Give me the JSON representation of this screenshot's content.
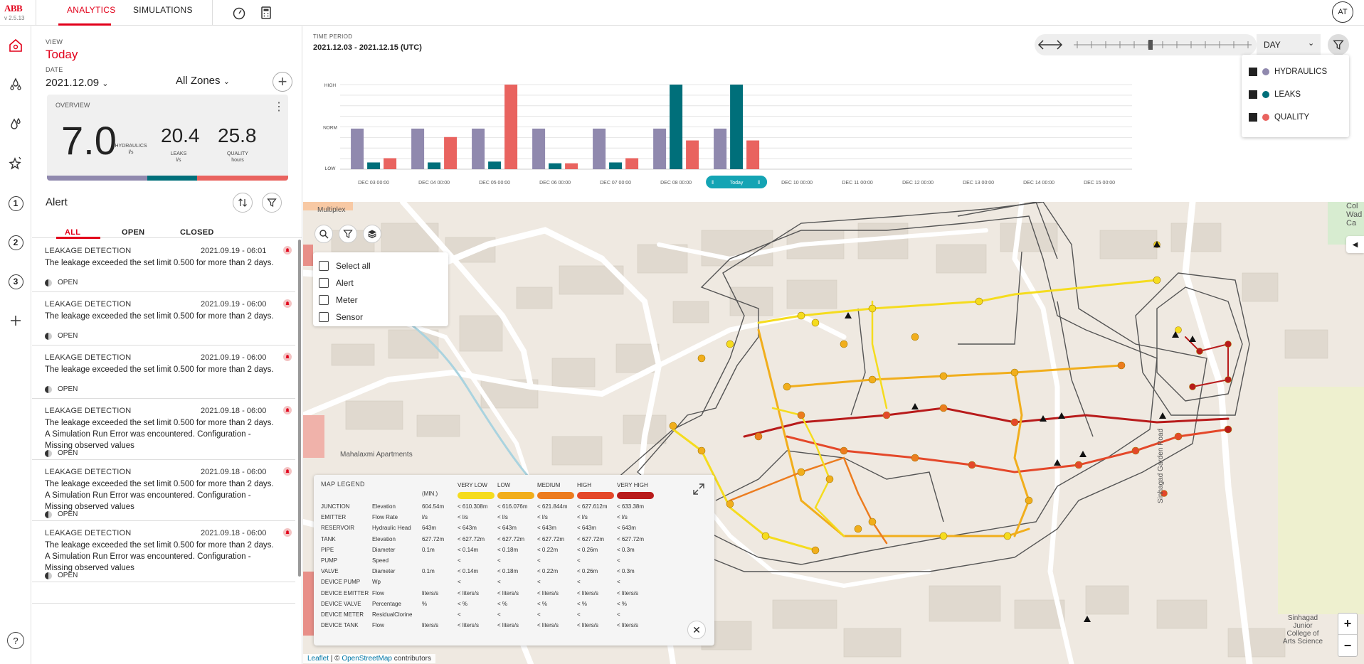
{
  "app": {
    "brand": "ABB",
    "version": "v 2.5.13",
    "avatar": "AT"
  },
  "topnav": {
    "tabs": [
      {
        "label": "ANALYTICS"
      },
      {
        "label": "SIMULATIONS"
      }
    ]
  },
  "sidebar": {
    "numbers": [
      "1",
      "2",
      "3"
    ],
    "help": "?"
  },
  "view": {
    "label": "VIEW",
    "value": "Today",
    "date_label": "DATE",
    "date_value": "2021.12.09",
    "zones": "All Zones"
  },
  "overview": {
    "label": "OVERVIEW",
    "hydraulics": {
      "value": "7.0",
      "label": "HYDRAULICS",
      "unit": "l/s"
    },
    "leaks": {
      "value": "20.4",
      "label": "LEAKS",
      "unit": "l/s"
    },
    "quality": {
      "value": "25.8",
      "label": "QUALITY",
      "unit": "hours"
    }
  },
  "alerts": {
    "title": "Alert",
    "tabs": [
      "ALL",
      "OPEN",
      "CLOSED"
    ],
    "items": [
      {
        "type": "LEAKAGE DETECTION",
        "time": "2021.09.19 - 06:01",
        "msg": "The leakage exceeded the set limit 0.500 for more than 2 days.",
        "status": "OPEN"
      },
      {
        "type": "LEAKAGE DETECTION",
        "time": "2021.09.19 - 06:00",
        "msg": "The leakage exceeded the set limit 0.500 for more than 2 days.",
        "status": "OPEN"
      },
      {
        "type": "LEAKAGE DETECTION",
        "time": "2021.09.19 - 06:00",
        "msg": "The leakage exceeded the set limit 0.500 for more than 2 days.",
        "status": "OPEN"
      },
      {
        "type": "LEAKAGE DETECTION",
        "time": "2021.09.18 - 06:00",
        "msg": "The leakage exceeded the set limit 0.500 for more than 2 days. A Simulation Run Error was encountered. Configuration - Missing observed values",
        "status": "OPEN"
      },
      {
        "type": "LEAKAGE DETECTION",
        "time": "2021.09.18 - 06:00",
        "msg": "The leakage exceeded the set limit 0.500 for more than 2 days. A Simulation Run Error was encountered. Configuration - Missing observed values",
        "status": "OPEN"
      },
      {
        "type": "LEAKAGE DETECTION",
        "time": "2021.09.18 - 06:00",
        "msg": "The leakage exceeded the set limit 0.500 for more than 2 days. A Simulation Run Error was encountered. Configuration - Missing observed values",
        "status": "OPEN"
      }
    ]
  },
  "time_period": {
    "label": "TIME PERIOD",
    "value": "2021.12.03 - 2021.12.15 (UTC)",
    "granularity": "DAY"
  },
  "chart_data": {
    "type": "bar",
    "categories": [
      "DEC 03 00:00",
      "DEC 04 00:00",
      "DEC 05 00:00",
      "DEC 06 00:00",
      "DEC 07 00:00",
      "DEC 08 00:00",
      "Today",
      "DEC 10 00:00",
      "DEC 11 00:00",
      "DEC 12 00:00",
      "DEC 13 00:00",
      "DEC 14 00:00",
      "DEC 15 00:00"
    ],
    "y_ticks": [
      "HIGH",
      "NORM",
      "LOW"
    ],
    "ylim": [
      0,
      1
    ],
    "series": [
      {
        "name": "HYDRAULICS",
        "color": "#9089ae",
        "values": [
          0.48,
          0.48,
          0.48,
          0.48,
          0.48,
          0.48,
          0.48,
          null,
          null,
          null,
          null,
          null,
          null
        ]
      },
      {
        "name": "LEAKS",
        "color": "#006f7a",
        "values": [
          0.08,
          0.08,
          0.09,
          0.07,
          0.08,
          1.0,
          1.0,
          null,
          null,
          null,
          null,
          null,
          null
        ]
      },
      {
        "name": "QUALITY",
        "color": "#e9635f",
        "values": [
          0.13,
          0.38,
          1.0,
          0.07,
          0.13,
          0.34,
          0.34,
          null,
          null,
          null,
          null,
          null,
          null
        ]
      }
    ],
    "highlight_category": "Today"
  },
  "legend": {
    "items": [
      {
        "label": "HYDRAULICS",
        "color": "#9089ae"
      },
      {
        "label": "LEAKS",
        "color": "#006f7a"
      },
      {
        "label": "QUALITY",
        "color": "#e9635f"
      }
    ]
  },
  "layers": {
    "items": [
      "Select all",
      "Alert",
      "Meter",
      "Sensor"
    ]
  },
  "map_labels": {
    "apartments": "Mahalaxmi Apartments",
    "road": "Sinhagad Garden Road",
    "college": "Sinhagad Junior College of Arts Science",
    "multiplex": "Multiplex",
    "edge": "Col Wad Ca"
  },
  "map_legend": {
    "title": "MAP LEGEND",
    "min_label": "(MIN.)",
    "levels": [
      {
        "label": "VERY LOW",
        "color": "#f5dc1e"
      },
      {
        "label": "LOW",
        "color": "#f1ae1c"
      },
      {
        "label": "MEDIUM",
        "color": "#ec7c1f"
      },
      {
        "label": "HIGH",
        "color": "#e4482a"
      },
      {
        "label": "VERY HIGH",
        "color": "#b81b1b"
      }
    ],
    "rows": [
      [
        "JUNCTION",
        "Elevation",
        "604.54m",
        "< 610.308m",
        "< 616.076m",
        "< 621.844m",
        "< 627.612m",
        "< 633.38m"
      ],
      [
        "EMITTER",
        "Flow Rate",
        "l/s",
        "< l/s",
        "< l/s",
        "< l/s",
        "< l/s",
        "< l/s"
      ],
      [
        "RESERVOIR",
        "Hydraulic Head",
        "643m",
        "< 643m",
        "< 643m",
        "< 643m",
        "< 643m",
        "< 643m"
      ],
      [
        "TANK",
        "Elevation",
        "627.72m",
        "< 627.72m",
        "< 627.72m",
        "< 627.72m",
        "< 627.72m",
        "< 627.72m"
      ],
      [
        "PIPE",
        "Diameter",
        "0.1m",
        "< 0.14m",
        "< 0.18m",
        "< 0.22m",
        "< 0.26m",
        "< 0.3m"
      ],
      [
        "PUMP",
        "Speed",
        "",
        "<",
        "<",
        "<",
        "<",
        "<"
      ],
      [
        "VALVE",
        "Diameter",
        "0.1m",
        "< 0.14m",
        "< 0.18m",
        "< 0.22m",
        "< 0.26m",
        "< 0.3m"
      ],
      [
        "DEVICE PUMP",
        "Wp",
        "",
        "<",
        "<",
        "<",
        "<",
        "<"
      ],
      [
        "DEVICE EMITTER",
        "Flow",
        "liters/s",
        "< liters/s",
        "< liters/s",
        "< liters/s",
        "< liters/s",
        "< liters/s"
      ],
      [
        "DEVICE VALVE",
        "Percentage",
        "%",
        "< %",
        "< %",
        "< %",
        "< %",
        "< %"
      ],
      [
        "DEVICE METER",
        "ResidualClorine",
        "",
        "<",
        "<",
        "<",
        "<",
        "<"
      ],
      [
        "DEVICE TANK",
        "Flow",
        "liters/s",
        "< liters/s",
        "< liters/s",
        "< liters/s",
        "< liters/s",
        "< liters/s"
      ]
    ]
  },
  "attribution": {
    "leaflet": "Leaflet",
    "sep": " | © ",
    "osm": "OpenStreetMap",
    "rest": " contributors"
  }
}
